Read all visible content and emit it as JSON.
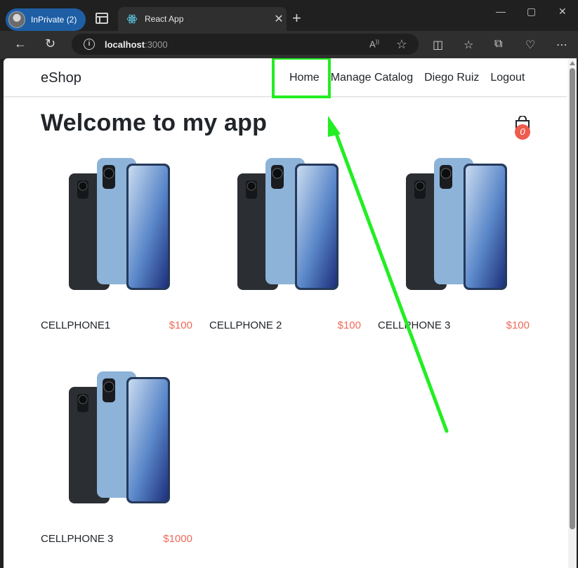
{
  "browser": {
    "profile_label": "InPrivate (2)",
    "tab_title": "React App",
    "url_host": "localhost",
    "url_port": ":3000"
  },
  "app": {
    "brand": "eShop",
    "nav": [
      "Home",
      "Manage Catalog",
      "Diego Ruiz",
      "Logout"
    ],
    "heading": "Welcome to my app",
    "cart_count": "0",
    "products": [
      {
        "name": "CELLPHONE1",
        "price": "$100"
      },
      {
        "name": "CELLPHONE 2",
        "price": "$100"
      },
      {
        "name": "CELLPHONE 3",
        "price": "$100"
      },
      {
        "name": "CELLPHONE 3",
        "price": "$1000"
      }
    ]
  },
  "colors": {
    "highlight": "#22ee22",
    "price": "#ef6a5b",
    "badge": "#ef5b4d",
    "inprivate": "#1d5ea5"
  },
  "icons": [
    "back-icon",
    "refresh-icon",
    "info-icon",
    "read-aloud-icon",
    "favorite-star-icon",
    "split-screen-icon",
    "favorites-icon",
    "collections-icon",
    "health-icon",
    "more-icon",
    "shopping-bag-icon"
  ]
}
